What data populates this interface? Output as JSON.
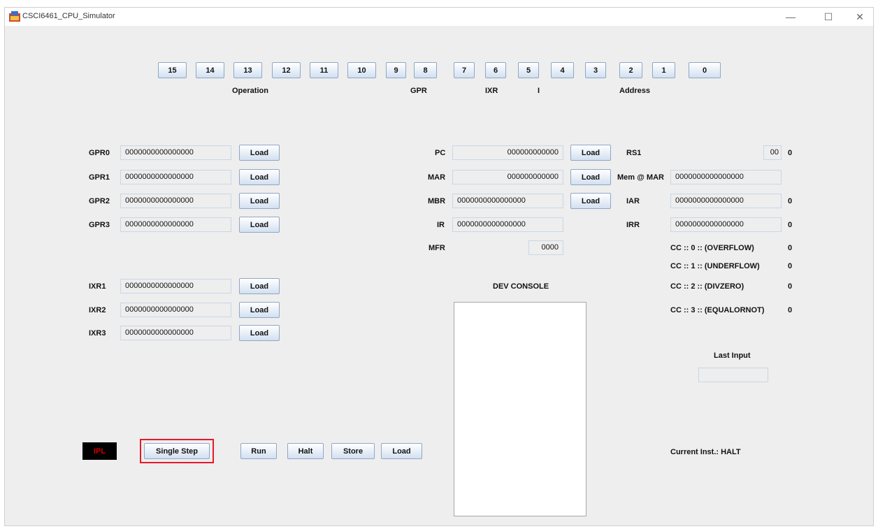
{
  "window": {
    "title": "CSCI6461_CPU_Simulator",
    "controls": {
      "minimize": "—",
      "maximize": "☐",
      "close": "✕"
    }
  },
  "bits": [
    "15",
    "14",
    "13",
    "12",
    "11",
    "10",
    "9",
    "8",
    "7",
    "6",
    "5",
    "4",
    "3",
    "2",
    "1",
    "0"
  ],
  "bit_groups": {
    "operation": "Operation",
    "gpr": "GPR",
    "ixr": "IXR",
    "i": "I",
    "address": "Address"
  },
  "registers": {
    "load_label": "Load",
    "gpr": [
      {
        "name": "GPR0",
        "value": "0000000000000000"
      },
      {
        "name": "GPR1",
        "value": "0000000000000000"
      },
      {
        "name": "GPR2",
        "value": "0000000000000000"
      },
      {
        "name": "GPR3",
        "value": "0000000000000000"
      }
    ],
    "ixr": [
      {
        "name": "IXR1",
        "value": "0000000000000000"
      },
      {
        "name": "IXR2",
        "value": "0000000000000000"
      },
      {
        "name": "IXR3",
        "value": "0000000000000000"
      }
    ],
    "pc": {
      "name": "PC",
      "value": "000000000000"
    },
    "mar": {
      "name": "MAR",
      "value": "000000000000"
    },
    "mbr": {
      "name": "MBR",
      "value": "0000000000000000"
    },
    "ir": {
      "name": "IR",
      "value": "0000000000000000"
    },
    "mfr": {
      "name": "MFR",
      "value": "0000"
    }
  },
  "right_panel": {
    "rs1": {
      "name": "RS1",
      "value": "00",
      "extra": "0"
    },
    "mem_at_mar": {
      "name": "Mem @ MAR",
      "value": "0000000000000000"
    },
    "iar": {
      "name": "IAR",
      "value": "0000000000000000",
      "extra": "0"
    },
    "irr": {
      "name": "IRR",
      "value": "0000000000000000",
      "extra": "0"
    },
    "cc": [
      {
        "label": "CC :: 0 :: (OVERFLOW)",
        "value": "0"
      },
      {
        "label": "CC :: 1 :: (UNDERFLOW)",
        "value": "0"
      },
      {
        "label": "CC :: 2 :: (DIVZERO)",
        "value": "0"
      },
      {
        "label": "CC :: 3 :: (EQUALORNOT)",
        "value": "0"
      }
    ],
    "last_input": {
      "label": "Last Input",
      "value": ""
    },
    "current_inst": "Current Inst.: HALT"
  },
  "console": {
    "title": "DEV CONSOLE",
    "text": ""
  },
  "controls": {
    "ipl": "IPL",
    "single_step": "Single Step",
    "run": "Run",
    "halt": "Halt",
    "store": "Store",
    "load": "Load"
  }
}
